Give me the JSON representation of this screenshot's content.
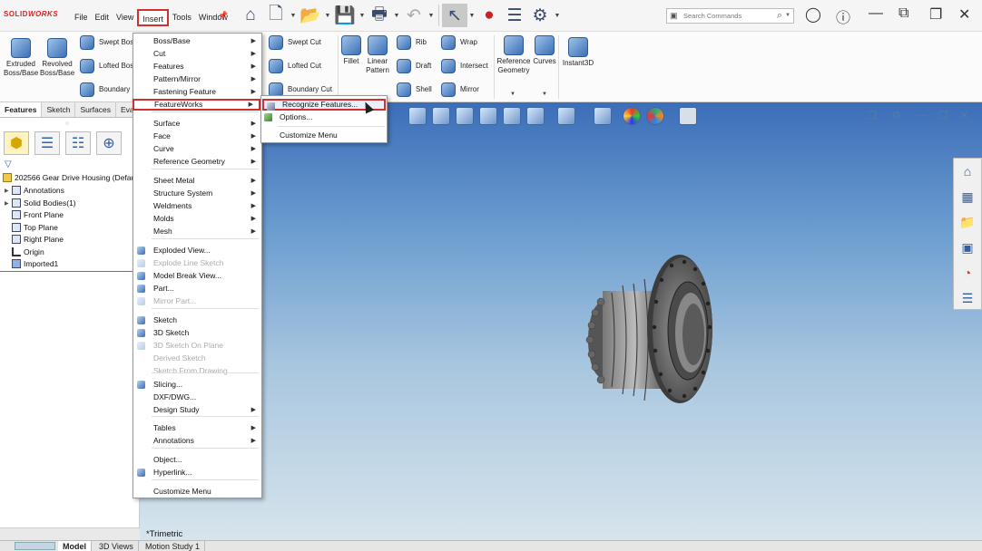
{
  "app": {
    "logo_brand": "SOLID",
    "logo_suffix": "WORKS"
  },
  "menubar": [
    "File",
    "Edit",
    "View",
    "Insert",
    "Tools",
    "Window"
  ],
  "search": {
    "placeholder": "Search Commands"
  },
  "command_manager": {
    "large": [
      "Extruded Boss/Base",
      "Revolved Boss/Base",
      "Fillet",
      "Linear Pattern",
      "Reference Geometry",
      "Curves",
      "Instant3D"
    ],
    "small": [
      "Swept Boss",
      "Lofted Boss",
      "Boundary",
      "Swept Cut",
      "Lofted Cut",
      "Boundary Cut",
      "Rib",
      "Draft",
      "Shell",
      "Wrap",
      "Intersect",
      "Mirror"
    ]
  },
  "fm_tabs": [
    "Features",
    "Sketch",
    "Surfaces",
    "Evalu"
  ],
  "tree": {
    "root": "202566 Gear Drive Housing  (Defau",
    "items": [
      "Annotations",
      "Solid Bodies(1)",
      "Front Plane",
      "Top Plane",
      "Right Plane",
      "Origin",
      "Imported1"
    ]
  },
  "insert_menu": [
    {
      "label": "Boss/Base",
      "sub": true
    },
    {
      "label": "Cut",
      "sub": true
    },
    {
      "label": "Features",
      "sub": true
    },
    {
      "label": "Pattern/Mirror",
      "sub": true
    },
    {
      "label": "Fastening Feature",
      "sub": true
    },
    {
      "label": "FeatureWorks",
      "sub": true
    },
    {
      "label": "Surface",
      "sub": true
    },
    {
      "label": "Face",
      "sub": true
    },
    {
      "label": "Curve",
      "sub": true
    },
    {
      "label": "Reference Geometry",
      "sub": true
    },
    {
      "label": "Sheet Metal",
      "sub": true
    },
    {
      "label": "Structure System",
      "sub": true
    },
    {
      "label": "Weldments",
      "sub": true
    },
    {
      "label": "Molds",
      "sub": true
    },
    {
      "label": "Mesh",
      "sub": true
    },
    {
      "label": "Exploded View...",
      "sub": false
    },
    {
      "label": "Explode Line Sketch",
      "sub": false
    },
    {
      "label": "Model Break View...",
      "sub": false
    },
    {
      "label": "Part...",
      "sub": false
    },
    {
      "label": "Mirror Part...",
      "sub": false
    },
    {
      "label": "Sketch",
      "sub": false
    },
    {
      "label": "3D Sketch",
      "sub": false
    },
    {
      "label": "3D Sketch On Plane",
      "sub": false
    },
    {
      "label": "Derived Sketch",
      "sub": false
    },
    {
      "label": "Sketch From Drawing",
      "sub": false
    },
    {
      "label": "Slicing...",
      "sub": false
    },
    {
      "label": "DXF/DWG...",
      "sub": false
    },
    {
      "label": "Design Study",
      "sub": true
    },
    {
      "label": "Tables",
      "sub": true
    },
    {
      "label": "Annotations",
      "sub": true
    },
    {
      "label": "Object...",
      "sub": false
    },
    {
      "label": "Hyperlink...",
      "sub": false
    },
    {
      "label": "Customize Menu",
      "sub": false
    }
  ],
  "featureworks_submenu": [
    "Recognize Features...",
    "Options...",
    "Customize Menu"
  ],
  "viewport": {
    "view_label": "*Trimetric"
  },
  "bottom_tabs": [
    "Model",
    "3D Views",
    "Motion Study 1"
  ]
}
